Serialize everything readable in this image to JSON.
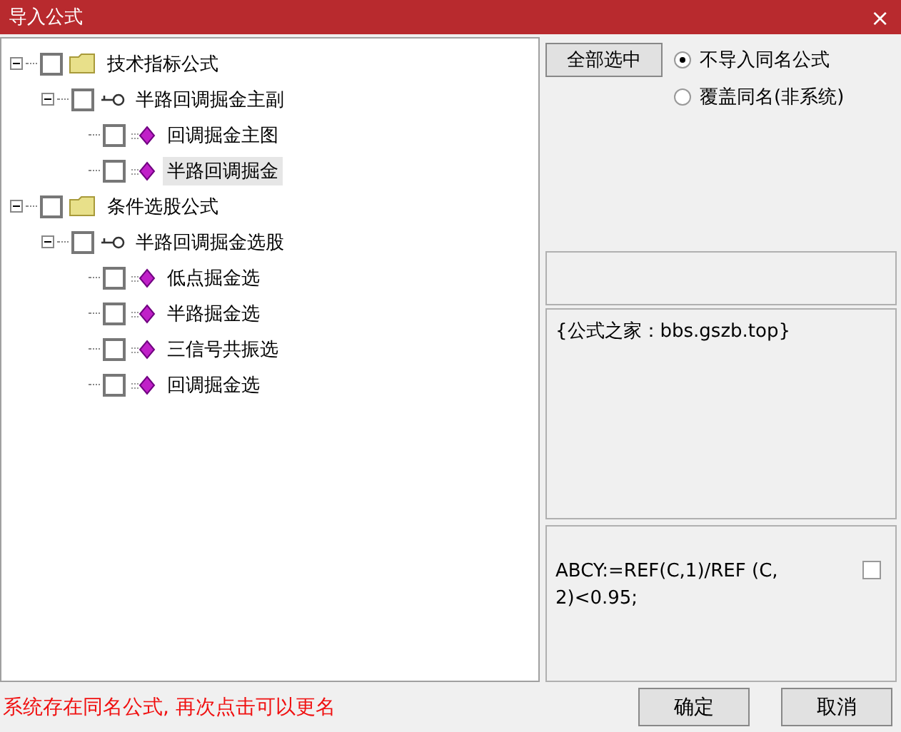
{
  "window": {
    "title": "导入公式",
    "close": "×"
  },
  "tree": [
    {
      "kind": "folder",
      "label": "技术指标公式",
      "checked": false,
      "expanded": true,
      "selected": false,
      "children": [
        {
          "kind": "group",
          "label": "半路回调掘金主副",
          "checked": false,
          "expanded": true,
          "selected": false,
          "children": [
            {
              "kind": "formula",
              "label": "回调掘金主图",
              "checked": false,
              "selected": false
            },
            {
              "kind": "formula",
              "label": "半路回调掘金",
              "checked": false,
              "selected": true
            }
          ]
        }
      ]
    },
    {
      "kind": "folder",
      "label": "条件选股公式",
      "checked": false,
      "expanded": true,
      "selected": false,
      "children": [
        {
          "kind": "group",
          "label": "半路回调掘金选股",
          "checked": false,
          "expanded": true,
          "selected": false,
          "children": [
            {
              "kind": "formula",
              "label": "低点掘金选",
              "checked": false,
              "selected": false
            },
            {
              "kind": "formula",
              "label": "半路掘金选",
              "checked": false,
              "selected": false
            },
            {
              "kind": "formula",
              "label": "三信号共振选",
              "checked": false,
              "selected": false
            },
            {
              "kind": "formula",
              "label": "回调掘金选",
              "checked": false,
              "selected": false
            }
          ]
        }
      ]
    }
  ],
  "select_all_button": "全部选中",
  "options": [
    {
      "label": "不导入同名公式",
      "selected": true
    },
    {
      "label": "覆盖同名(非系统)",
      "selected": false
    }
  ],
  "info_text": "{公式之家：bbs.gszb.top}",
  "code_text": "ABCY:=REF(C,1)/REF (C,2)<0.95;",
  "code_checkbox": {
    "checked": false
  },
  "status": "系统存在同名公式, 再次点击可以更名",
  "buttons": [
    "确定",
    "取消"
  ]
}
